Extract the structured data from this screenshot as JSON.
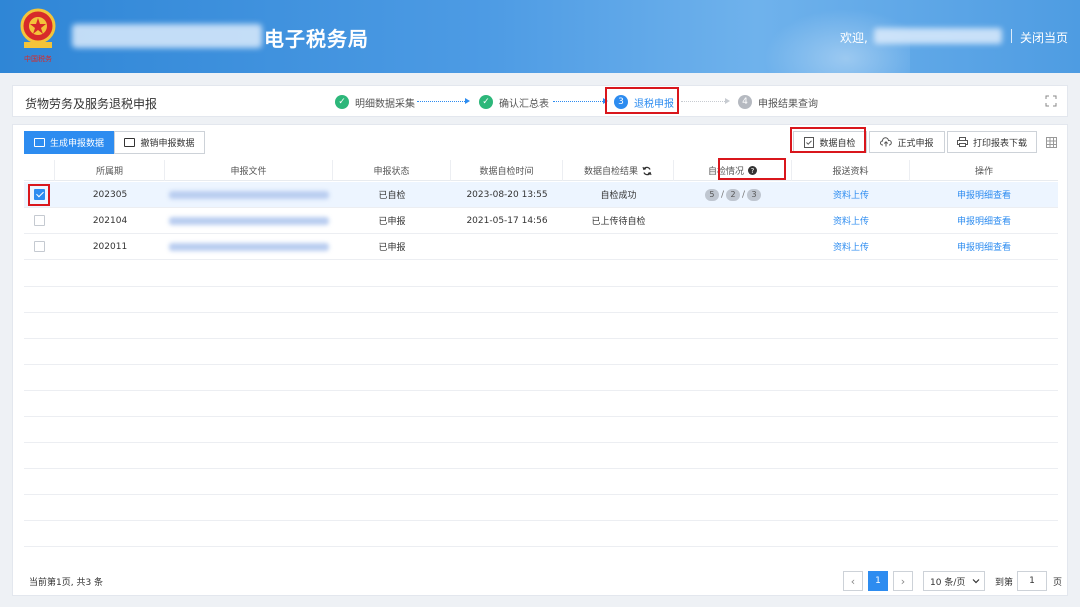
{
  "header": {
    "site_title": "电子税务局",
    "welcome": "欢迎,",
    "close_page": "关闭当页"
  },
  "stepbar": {
    "page_title": "货物劳务及服务退税申报",
    "steps": [
      {
        "num": "✓",
        "label": "明细数据采集",
        "state": "done"
      },
      {
        "num": "✓",
        "label": "确认汇总表",
        "state": "done"
      },
      {
        "num": "3",
        "label": "退税申报",
        "state": "active"
      },
      {
        "num": "4",
        "label": "申报结果查询",
        "state": "todo"
      }
    ]
  },
  "tabs": {
    "generate": "生成申报数据",
    "revoke": "撤销申报数据"
  },
  "toolbar": {
    "self_check": "数据自检",
    "formal_submit": "正式申报",
    "print_download": "打印报表下载"
  },
  "table": {
    "columns": [
      "所属期",
      "申报文件",
      "申报状态",
      "数据自检时间",
      "数据自检结果",
      "自检情况",
      "报送资料",
      "操作"
    ],
    "rows": [
      {
        "period": "202305",
        "status": "已自检",
        "check_time": "2023-08-20 13:55",
        "check_result": "自检成功",
        "counts": [
          "5",
          "2",
          "3"
        ],
        "upload": "资料上传",
        "action": "申报明细查看",
        "checked": true
      },
      {
        "period": "202104",
        "status": "已申报",
        "check_time": "2021-05-17 14:56",
        "check_result": "已上传待自检",
        "counts": [],
        "upload": "资料上传",
        "action": "申报明细查看",
        "checked": false
      },
      {
        "period": "202011",
        "status": "已申报",
        "check_time": "",
        "check_result": "",
        "counts": [],
        "upload": "资料上传",
        "action": "申报明细查看",
        "checked": false
      }
    ]
  },
  "footer": {
    "total": "当前第1页, 共3 条",
    "current_page": "1",
    "page_size": "10 条/页",
    "goto_label": "到第",
    "goto_value": "1",
    "page_unit": "页"
  },
  "colors": {
    "primary": "#2d8cf0",
    "done": "#2db77a",
    "highlight": "#d9161c",
    "header": "#3a8fdc"
  }
}
